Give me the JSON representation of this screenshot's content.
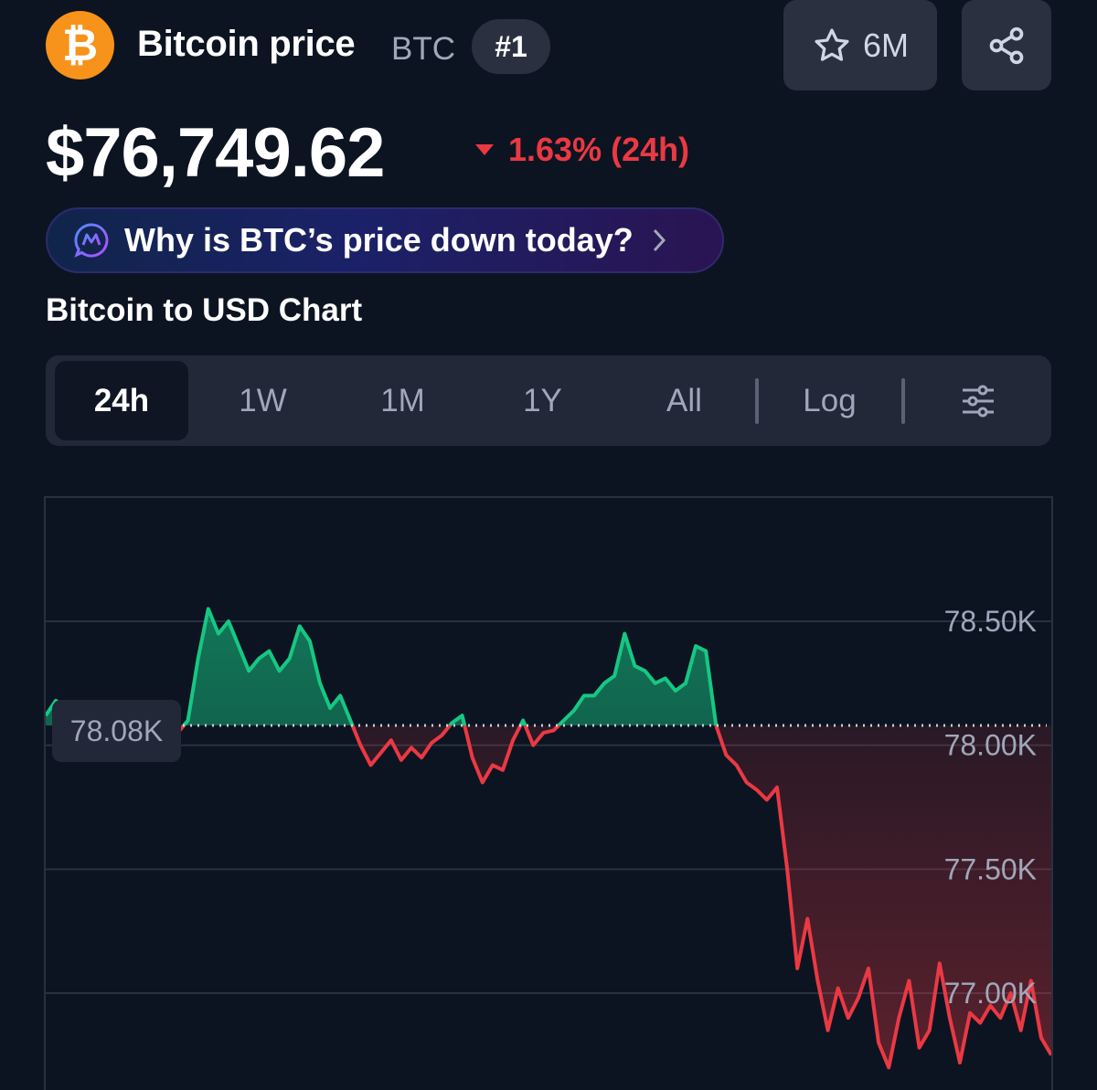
{
  "header": {
    "coin_name": "Bitcoin price",
    "symbol": "BTC",
    "rank": "#1",
    "watchlist_count": "6M",
    "price": "$76,749.62",
    "change": "1.63% (24h)",
    "change_direction": "down",
    "logo_glyph": "₿"
  },
  "ai_banner": {
    "text": "Why is BTC’s price down today?"
  },
  "chart_title": "Bitcoin to USD Chart",
  "tabs": [
    {
      "label": "24h",
      "active": true
    },
    {
      "label": "1W",
      "active": false
    },
    {
      "label": "1M",
      "active": false
    },
    {
      "label": "1Y",
      "active": false
    },
    {
      "label": "All",
      "active": false
    },
    {
      "label": "Log",
      "active": false
    }
  ],
  "colors": {
    "up": "#16c784",
    "down": "#ea3943",
    "background": "#0d1421",
    "brand": "#f7931a"
  },
  "icons": [
    "bitcoin-logo-icon",
    "star-icon",
    "share-icon",
    "ai-assistant-icon",
    "chevron-right-icon",
    "settings-sliders-icon",
    "caret-down-icon"
  ],
  "chart_data": {
    "type": "area",
    "title": "Bitcoin to USD Chart",
    "timeframe": "24h",
    "reference_value": 78.08,
    "reference_label": "78.08K",
    "y_unit": "K USD",
    "ylim": [
      76.7,
      79.0
    ],
    "y_ticks": [
      78.5,
      78.0,
      77.5,
      77.0
    ],
    "y_tick_labels": [
      "78.50K",
      "78.00K",
      "77.50K",
      "77.00K"
    ],
    "grid": true,
    "x": [
      0,
      1,
      2,
      3,
      4,
      5,
      6,
      7,
      8,
      9,
      10,
      11,
      12,
      13,
      14,
      15,
      16,
      17,
      18,
      19,
      20,
      21,
      22,
      23,
      24,
      25,
      26,
      27,
      28,
      29,
      30,
      31,
      32,
      33,
      34,
      35,
      36,
      37,
      38,
      39,
      40,
      41,
      42,
      43,
      44,
      45,
      46,
      47,
      48,
      49,
      50,
      51,
      52,
      53,
      54,
      55,
      56,
      57,
      58,
      59,
      60,
      61,
      62,
      63,
      64,
      65,
      66,
      67,
      68,
      69,
      70,
      71,
      72,
      73,
      74,
      75,
      76,
      77,
      78,
      79,
      80,
      81,
      82,
      83,
      84,
      85,
      86,
      87,
      88,
      89,
      90,
      91,
      92,
      93,
      94,
      95,
      96,
      97,
      98,
      99
    ],
    "values": [
      78.12,
      78.18,
      78.15,
      78.1,
      78.09,
      78.11,
      78.15,
      78.12,
      78.1,
      78.14,
      78.1,
      78.12,
      78.09,
      78.05,
      78.1,
      78.35,
      78.55,
      78.45,
      78.5,
      78.4,
      78.3,
      78.35,
      78.38,
      78.3,
      78.35,
      78.48,
      78.42,
      78.25,
      78.15,
      78.2,
      78.1,
      78.0,
      77.92,
      77.97,
      78.02,
      77.94,
      77.99,
      77.95,
      78.01,
      78.04,
      78.09,
      78.12,
      77.95,
      77.85,
      77.92,
      77.9,
      78.02,
      78.1,
      78.0,
      78.05,
      78.06,
      78.1,
      78.14,
      78.2,
      78.2,
      78.25,
      78.28,
      78.45,
      78.32,
      78.3,
      78.25,
      78.27,
      78.22,
      78.25,
      78.4,
      78.38,
      78.08,
      77.96,
      77.92,
      77.85,
      77.82,
      77.78,
      77.83,
      77.5,
      77.1,
      77.3,
      77.05,
      76.85,
      77.02,
      76.9,
      76.98,
      77.1,
      76.8,
      76.7,
      76.9,
      77.05,
      76.78,
      76.85,
      77.12,
      76.9,
      76.72,
      76.92,
      76.88,
      76.95,
      76.9,
      77.0,
      76.85,
      77.05,
      76.82,
      76.75
    ]
  }
}
